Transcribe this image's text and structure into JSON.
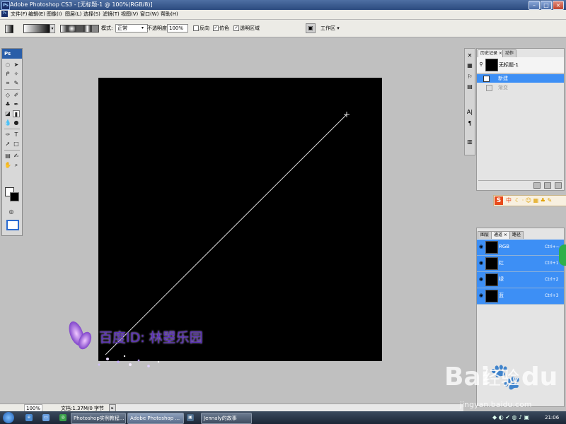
{
  "window": {
    "title": "Adobe Photoshop CS3 - [无标题-1 @ 100%(RGB/8)]",
    "ps_icon": "Ps"
  },
  "menu": [
    "文件(F)",
    "编辑(E)",
    "图像(I)",
    "图层(L)",
    "选择(S)",
    "滤镜(T)",
    "视图(V)",
    "窗口(W)",
    "帮助(H)"
  ],
  "options": {
    "mode_label": "模式:",
    "mode_value": "正常",
    "opacity_label": "不透明度:",
    "opacity_value": "100%",
    "reverse_label": "反向",
    "reverse_checked": false,
    "dither_label": "仿色",
    "dither_checked": true,
    "transparency_label": "透明区域",
    "transparency_checked": true,
    "workspace_label": "工作区 ▾"
  },
  "toolbox": {
    "logo": "Ps"
  },
  "history_panel": {
    "tabs": [
      "历史记录",
      "动作"
    ],
    "snapshot": "无标题-1",
    "items": [
      "新建",
      "渐变"
    ]
  },
  "ime_toolbar": {
    "logo": "S",
    "text": "中"
  },
  "channels_panel": {
    "tabs": [
      "图层",
      "通道",
      "路径"
    ],
    "rows": [
      {
        "name": "RGB",
        "shortcut": "Ctrl+~"
      },
      {
        "name": "红",
        "shortcut": "Ctrl+1"
      },
      {
        "name": "绿",
        "shortcut": "Ctrl+2"
      },
      {
        "name": "蓝",
        "shortcut": "Ctrl+3"
      }
    ]
  },
  "status": {
    "zoom": "100%",
    "doc_info": "文档:1.37M/0 字节"
  },
  "watermark": {
    "text": "百度ID: 林曌乐园"
  },
  "baidu": {
    "logo": "Bai",
    "paw": "du",
    "jingyan": "经验",
    "url": "jingyan.baidu.com"
  },
  "taskbar": {
    "buttons": [
      "Photoshop实例教程...",
      "Adobe Photoshop ...",
      "Jennaly的故事"
    ],
    "clock": "21:06"
  },
  "colors": {
    "title_bar": "#2c4b7f",
    "panel_selection": "#3d8ff5",
    "canvas": "#000000",
    "workspace": "#c0c0c0",
    "watermark_text": "#5a2fb8"
  },
  "icons": [
    "ps-icon",
    "gradient-tool-icon",
    "move-icon",
    "lasso-icon",
    "brush-icon",
    "eye-icon",
    "butterfly-icon",
    "workspace-icon"
  ]
}
